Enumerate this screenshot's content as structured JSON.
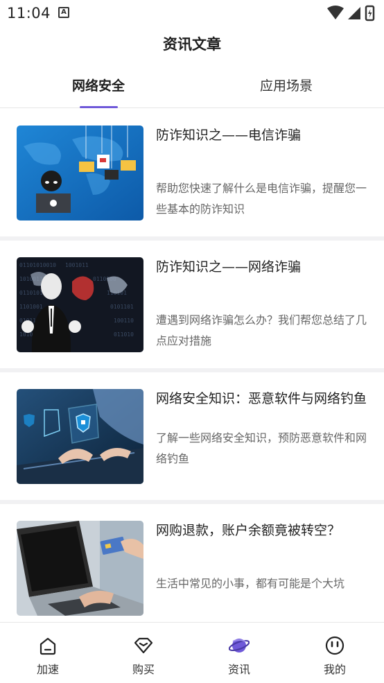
{
  "status_bar": {
    "time": "11:04",
    "notification_icon": "A"
  },
  "header": {
    "title": "资讯文章"
  },
  "tabs": [
    {
      "label": "网络安全",
      "active": true
    },
    {
      "label": "应用场景",
      "active": false
    }
  ],
  "articles": [
    {
      "title": "防诈知识之——电信诈骗",
      "description": "帮助您快速了解什么是电信诈骗，提醒您一些基本的防诈知识",
      "image": "hacker-world-map-image"
    },
    {
      "title": "防诈知识之——网络诈骗",
      "description": "遭遇到网络诈骗怎么办？我们帮您总结了几点应对措施",
      "image": "masked-man-binary-image"
    },
    {
      "title": "网络安全知识：恶意软件与网络钓鱼",
      "description": "了解一些网络安全知识，预防恶意软件和网络钓鱼",
      "image": "laptop-security-shield-image"
    },
    {
      "title": "网购退款，账户余额竟被转空？",
      "description": "生活中常见的小事，都有可能是个大坑",
      "image": "laptop-credit-card-image"
    }
  ],
  "bottom_nav": [
    {
      "label": "加速",
      "icon": "home-icon"
    },
    {
      "label": "购买",
      "icon": "diamond-icon"
    },
    {
      "label": "资讯",
      "icon": "planet-icon",
      "active": true
    },
    {
      "label": "我的",
      "icon": "smiley-icon"
    }
  ],
  "colors": {
    "accent": "#6f59d9",
    "divider": "#f1f1f3"
  }
}
